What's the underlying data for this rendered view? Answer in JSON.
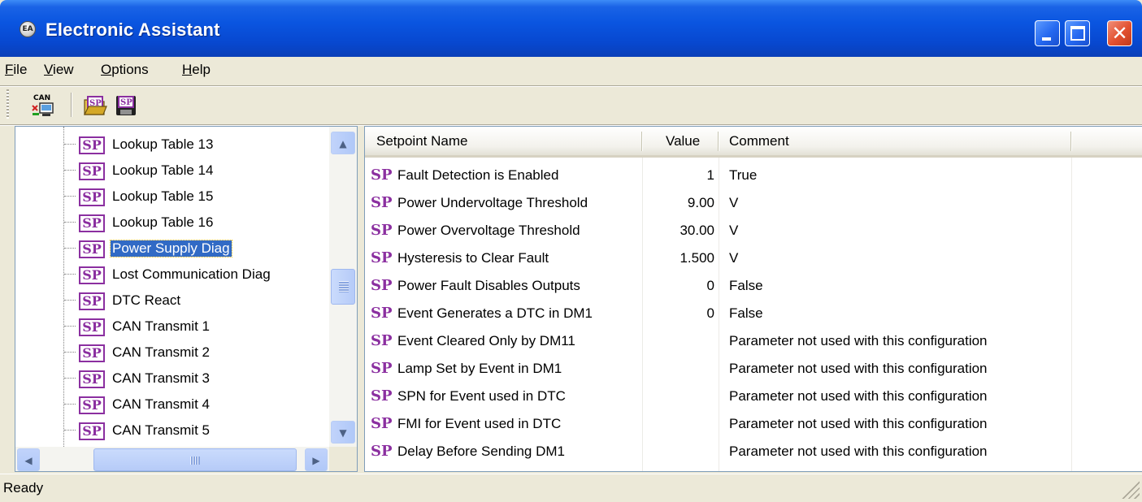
{
  "window": {
    "title": "Electronic Assistant",
    "app_icon": "ea-logo-icon",
    "controls": [
      "minimize-icon",
      "maximize-icon",
      "close-icon"
    ]
  },
  "menubar": {
    "items": [
      {
        "label_u": "F",
        "label_rest": "ile"
      },
      {
        "label_u": "V",
        "label_rest": "iew"
      },
      {
        "label_u": "O",
        "label_rest": "ptions"
      },
      {
        "label_u": "H",
        "label_rest": "elp"
      }
    ]
  },
  "toolbar": {
    "buttons": [
      {
        "icon": "can-connect-icon",
        "text": "CAN"
      },
      {
        "icon": "open-setpoint-file-icon",
        "text": "SP"
      },
      {
        "icon": "save-setpoint-file-icon",
        "text": "SP"
      }
    ]
  },
  "tree": {
    "icon_text": "SP",
    "items": [
      {
        "label": "Lookup Table 13",
        "selected": false
      },
      {
        "label": "Lookup Table 14",
        "selected": false
      },
      {
        "label": "Lookup Table 15",
        "selected": false
      },
      {
        "label": "Lookup Table 16",
        "selected": false
      },
      {
        "label": "Power Supply Diag",
        "selected": true
      },
      {
        "label": "Lost Communication Diag",
        "selected": false
      },
      {
        "label": "DTC React",
        "selected": false
      },
      {
        "label": "CAN Transmit 1",
        "selected": false
      },
      {
        "label": "CAN Transmit 2",
        "selected": false
      },
      {
        "label": "CAN Transmit 3",
        "selected": false
      },
      {
        "label": "CAN Transmit 4",
        "selected": false
      },
      {
        "label": "CAN Transmit 5",
        "selected": false
      }
    ]
  },
  "grid": {
    "columns": [
      "Setpoint Name",
      "Value",
      "Comment"
    ],
    "icon_text": "SP",
    "rows": [
      {
        "name": "Fault Detection is Enabled",
        "value": "1",
        "comment": "True"
      },
      {
        "name": "Power Undervoltage Threshold",
        "value": "9.00",
        "comment": "V"
      },
      {
        "name": "Power Overvoltage Threshold",
        "value": "30.00",
        "comment": "V"
      },
      {
        "name": "Hysteresis to Clear Fault",
        "value": "1.500",
        "comment": "V"
      },
      {
        "name": "Power Fault Disables Outputs",
        "value": "0",
        "comment": "False"
      },
      {
        "name": "Event Generates a DTC in DM1",
        "value": "0",
        "comment": "False"
      },
      {
        "name": "Event Cleared Only by DM11",
        "value": "",
        "comment": "Parameter not used with this configuration"
      },
      {
        "name": "Lamp Set by Event in DM1",
        "value": "",
        "comment": "Parameter not used with this configuration"
      },
      {
        "name": "SPN for Event used in DTC",
        "value": "",
        "comment": "Parameter not used with this configuration"
      },
      {
        "name": "FMI for Event used in DTC",
        "value": "",
        "comment": "Parameter not used with this configuration"
      },
      {
        "name": "Delay Before Sending DM1",
        "value": "",
        "comment": "Parameter not used with this configuration"
      }
    ]
  },
  "statusbar": {
    "text": "Ready"
  },
  "scrollbars": {
    "up_glyph": "▲",
    "down_glyph": "▼",
    "left_glyph": "◀",
    "right_glyph": "▶"
  },
  "colors": {
    "titlebar": "#0a55e0",
    "sp_icon": "#8b2fa0",
    "selection": "#316ac5"
  }
}
